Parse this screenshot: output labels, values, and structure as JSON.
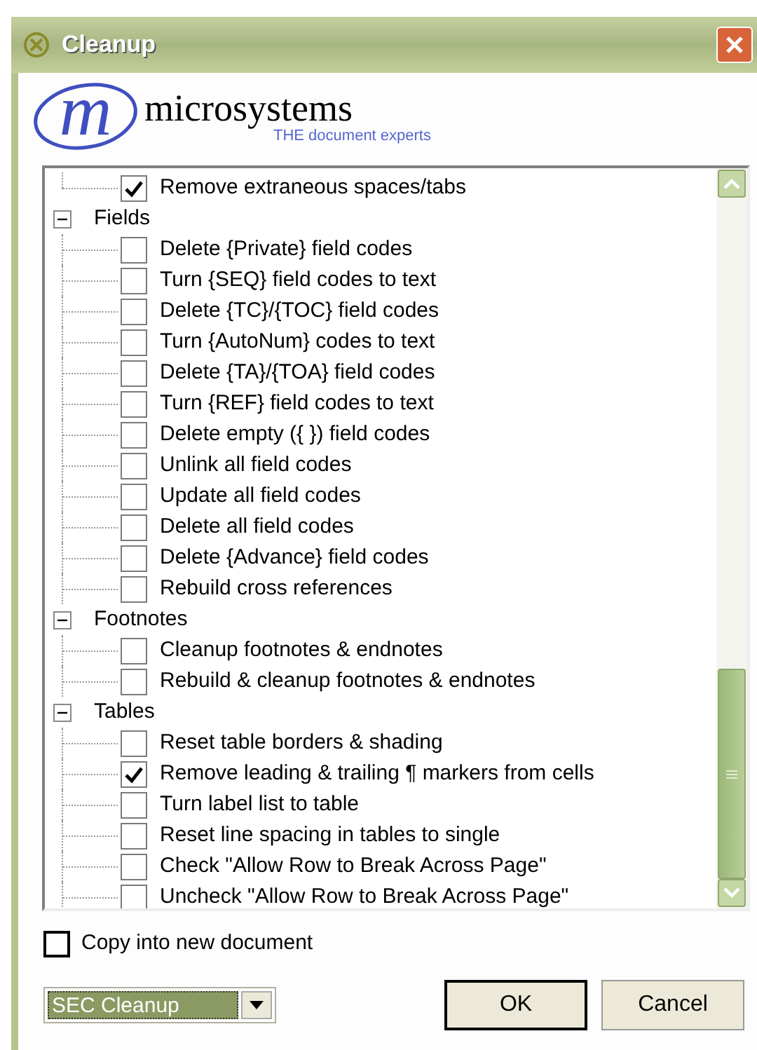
{
  "window": {
    "title": "Cleanup"
  },
  "logo": {
    "letter": "m",
    "name": "microsystems",
    "tagline": "THE document experts"
  },
  "tree": [
    {
      "kind": "option",
      "label": "Remove extraneous spaces/tabs",
      "checked": true
    },
    {
      "kind": "group",
      "label": "Fields",
      "expanded": true,
      "children": [
        {
          "kind": "option",
          "label": "Delete {Private} field codes",
          "checked": false
        },
        {
          "kind": "option",
          "label": "Turn {SEQ} field codes to text",
          "checked": false
        },
        {
          "kind": "option",
          "label": "Delete {TC}/{TOC} field codes",
          "checked": false
        },
        {
          "kind": "option",
          "label": "Turn {AutoNum} codes to text",
          "checked": false
        },
        {
          "kind": "option",
          "label": "Delete {TA}/{TOA} field codes",
          "checked": false
        },
        {
          "kind": "option",
          "label": "Turn {REF} field codes to text",
          "checked": false
        },
        {
          "kind": "option",
          "label": "Delete empty ({  }) field codes",
          "checked": false
        },
        {
          "kind": "option",
          "label": "Unlink all field codes",
          "checked": false
        },
        {
          "kind": "option",
          "label": "Update all field codes",
          "checked": false
        },
        {
          "kind": "option",
          "label": "Delete all field codes",
          "checked": false
        },
        {
          "kind": "option",
          "label": "Delete {Advance} field codes",
          "checked": false
        },
        {
          "kind": "option",
          "label": "Rebuild cross references",
          "checked": false
        }
      ]
    },
    {
      "kind": "group",
      "label": "Footnotes",
      "expanded": true,
      "children": [
        {
          "kind": "option",
          "label": "Cleanup footnotes & endnotes",
          "checked": false
        },
        {
          "kind": "option",
          "label": "Rebuild & cleanup footnotes & endnotes",
          "checked": false
        }
      ]
    },
    {
      "kind": "group",
      "label": "Tables",
      "expanded": true,
      "children": [
        {
          "kind": "option",
          "label": "Reset table borders & shading",
          "checked": false
        },
        {
          "kind": "option",
          "label": "Remove leading & trailing ¶ markers from cells",
          "checked": true
        },
        {
          "kind": "option",
          "label": "Turn label list to table",
          "checked": false
        },
        {
          "kind": "option",
          "label": "Reset line spacing in tables to single",
          "checked": false
        },
        {
          "kind": "option",
          "label": "Check \"Allow Row to Break Across Page\"",
          "checked": false
        },
        {
          "kind": "option",
          "label": "Uncheck \"Allow Row to Break Across Page\"",
          "checked": false
        }
      ]
    }
  ],
  "copy_option": {
    "label": "Copy into new document",
    "checked": false
  },
  "profile_dropdown": {
    "value": "SEC Cleanup"
  },
  "buttons": [
    {
      "label": "OK",
      "default": true
    },
    {
      "label": "Cancel",
      "default": false
    }
  ]
}
